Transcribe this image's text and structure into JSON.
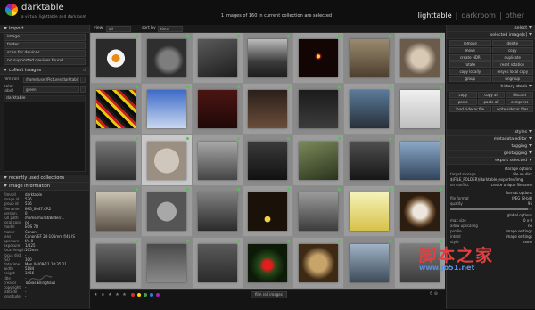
{
  "app": {
    "name": "darktable",
    "tagline": "a virtual lighttable and darkroom",
    "status": "1 images of 160 in current collection are selected",
    "views": [
      "lighttable",
      "|",
      "darkroom",
      "|",
      "other"
    ]
  },
  "left": {
    "import": {
      "title": "import",
      "buttons": [
        "image",
        "folder",
        "scan for devices",
        "no supported devices found"
      ]
    },
    "collect": {
      "title": "collect images",
      "film_roll_label": "film roll",
      "film_roll_value": "/home/user/Pictures/darktable_pro",
      "color_label": "color label",
      "color_value": "green",
      "list": [
        "darktable"
      ]
    },
    "recent": {
      "title": "recently used collections"
    },
    "info": {
      "title": "image information",
      "rows": [
        {
          "k": "filmroll",
          "v": "darktable"
        },
        {
          "k": "image id",
          "v": "576"
        },
        {
          "k": "group id",
          "v": "576"
        },
        {
          "k": "filename",
          "v": "IMG_0047.CR2"
        },
        {
          "k": "version",
          "v": "0"
        },
        {
          "k": "full path",
          "v": "/home/murat/Bilder/..."
        },
        {
          "k": "local copy",
          "v": "no"
        },
        {
          "k": "model",
          "v": "EOS 7D"
        },
        {
          "k": "maker",
          "v": "Canon"
        },
        {
          "k": "lens",
          "v": "Canon EF 24-105mm f/4L IS"
        },
        {
          "k": "aperture",
          "v": "f/4.0"
        },
        {
          "k": "exposure",
          "v": "1/125"
        },
        {
          "k": "focal length",
          "v": "105mm"
        },
        {
          "k": "focus dist.",
          "v": "-"
        },
        {
          "k": "ISO",
          "v": "100"
        },
        {
          "k": "datetime",
          "v": "Mon 04/09/11 10:35:11"
        },
        {
          "k": "width",
          "v": "5184"
        },
        {
          "k": "height",
          "v": "3456"
        },
        {
          "k": "title",
          "v": "-"
        },
        {
          "k": "creator",
          "v": "Tobias Ellinghaus"
        },
        {
          "k": "copyright",
          "v": "-"
        },
        {
          "k": "latitude",
          "v": "-"
        },
        {
          "k": "longitude",
          "v": "-"
        }
      ]
    }
  },
  "center": {
    "head": {
      "view_label": "view",
      "view_value": "all",
      "sort_label": "sort by",
      "sort_value": "time"
    },
    "bottom": {
      "stars": "★ ★ ★ ★ ★",
      "selector": "film roll images",
      "zoom": "6 ⊕"
    },
    "color_labels": [
      "#d32f2f",
      "#ffd600",
      "#43a047",
      "#1e88e5",
      "#9c27b0"
    ]
  },
  "right": {
    "select_title": "select",
    "selected_title": "selected image[s]",
    "selected_buttons": [
      "remove",
      "delete",
      "move",
      "copy",
      "create HDR",
      "duplicate",
      "rotate",
      "reset rotation",
      "copy locally",
      "resync local copy",
      "group",
      "ungroup"
    ],
    "history_title": "history stack",
    "history_buttons": [
      "copy",
      "copy all",
      "discard",
      "paste",
      "paste all",
      "compress",
      "load sidecar file",
      "write sidecar files"
    ],
    "styles_title": "styles",
    "metadata_title": "metadata editor",
    "tagging_title": "tagging",
    "geotagging_title": "geotagging",
    "export_title": "export selected",
    "storage_title": "storage options",
    "storage_target_label": "target storage",
    "storage_target_value": "file on disk",
    "storage_path": "$(FILE_FOLDER)/darktable_exported/img",
    "on_conflict_label": "on conflict",
    "on_conflict_value": "create unique filename",
    "format_title": "format options",
    "file_format_label": "file format",
    "file_format_value": "JPEG (8-bit)",
    "quality_label": "quality",
    "quality_value": "95",
    "global_title": "global options",
    "max_size_label": "max size",
    "max_size_value": "0 x 0",
    "upscale_label": "allow upscaling",
    "upscale_value": "no",
    "profile_label": "profile",
    "profile_value": "image settings",
    "intent_label": "intent",
    "intent_value": "image settings",
    "style_label": "style",
    "style_value": "none",
    "export_button": "export"
  },
  "watermark": {
    "cn": "脚本之家",
    "url": "www.jb51.net"
  }
}
